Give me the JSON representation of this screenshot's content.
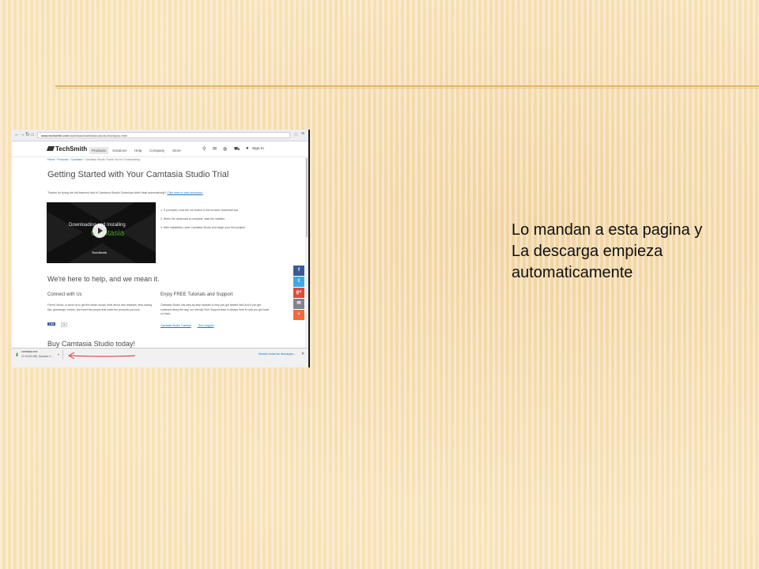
{
  "browser": {
    "url_domain": "www.techsmith.com",
    "url_path": "/download/camtasia-studio-thankyou.html",
    "back_icon": "arrow-left-icon",
    "forward_icon": "arrow-right-icon",
    "reload_icon": "reload-icon",
    "home_icon": "home-icon"
  },
  "site_nav": {
    "logo": "TechSmith",
    "items": [
      "Products",
      "Solutions",
      "Help",
      "Company",
      "Store"
    ],
    "active_item": "Products",
    "icons": [
      "search-icon",
      "mail-icon",
      "globe-icon",
      "cart-icon"
    ],
    "sign_in": "Sign In"
  },
  "breadcrumb": {
    "items": [
      "Home",
      "Products",
      "Camtasia"
    ],
    "current": "Camtasia Studio Thank You for Downloading"
  },
  "page": {
    "title": "Getting Started with Your Camtasia Studio Trial",
    "intro_text": "Thanks for trying the full-featured trial of Camtasia Studio! Download didn't start automatically?",
    "intro_link": "Click here to start download.",
    "video": {
      "line1": "Downloading and Installing",
      "line2": "Camtasia",
      "brand": "TechSmith"
    },
    "steps": [
      "1. If prompted, click the run button in the browser download bar.",
      "2. When the download is complete, start the installer.",
      "3. After installation, start Camtasia Studio and begin your first project!"
    ],
    "help_heading": "We're here to help, and we mean it.",
    "connect_heading": "Connect with Us",
    "connect_text": "Friend, follow, or circle us to get the inside scoop! Hear about new releases, time-saving tips, giveaways, events, and meet the people that make the products you love.",
    "like_label": "Like",
    "like_count": "1k",
    "tutorials_heading": "Enjoy FREE Tutorials and Support",
    "tutorials_text": "Camtasia Studio has step-by-step tutorials to help you get started fast! And if you get confused along the way, our friendly Tech Support team is always here to help you get back on track.",
    "tutorial_links": [
      "Camtasia Studio Tutorials",
      "Tech Support"
    ],
    "buy_heading": "Buy Camtasia Studio today!"
  },
  "social_buttons": [
    {
      "icon": "facebook-icon",
      "glyph": "f",
      "color": "#3b5998"
    },
    {
      "icon": "twitter-icon",
      "glyph": "t",
      "color": "#3fa9e0"
    },
    {
      "icon": "google-plus-icon",
      "glyph": "g+",
      "color": "#dd4b39"
    },
    {
      "icon": "email-icon",
      "glyph": "✉",
      "color": "#7b8691"
    },
    {
      "icon": "share-plus-icon",
      "glyph": "+",
      "color": "#f26b3a"
    }
  ],
  "download_bar": {
    "file_name": "camtasia.exe",
    "status": "12.3/240 MB, Quedan 4 ...",
    "show_all": "Mostrar todas las descargas..."
  },
  "caption": {
    "lines": [
      "Lo mandan a esta pagina y",
      "La descarga empieza",
      "automaticamente"
    ]
  }
}
